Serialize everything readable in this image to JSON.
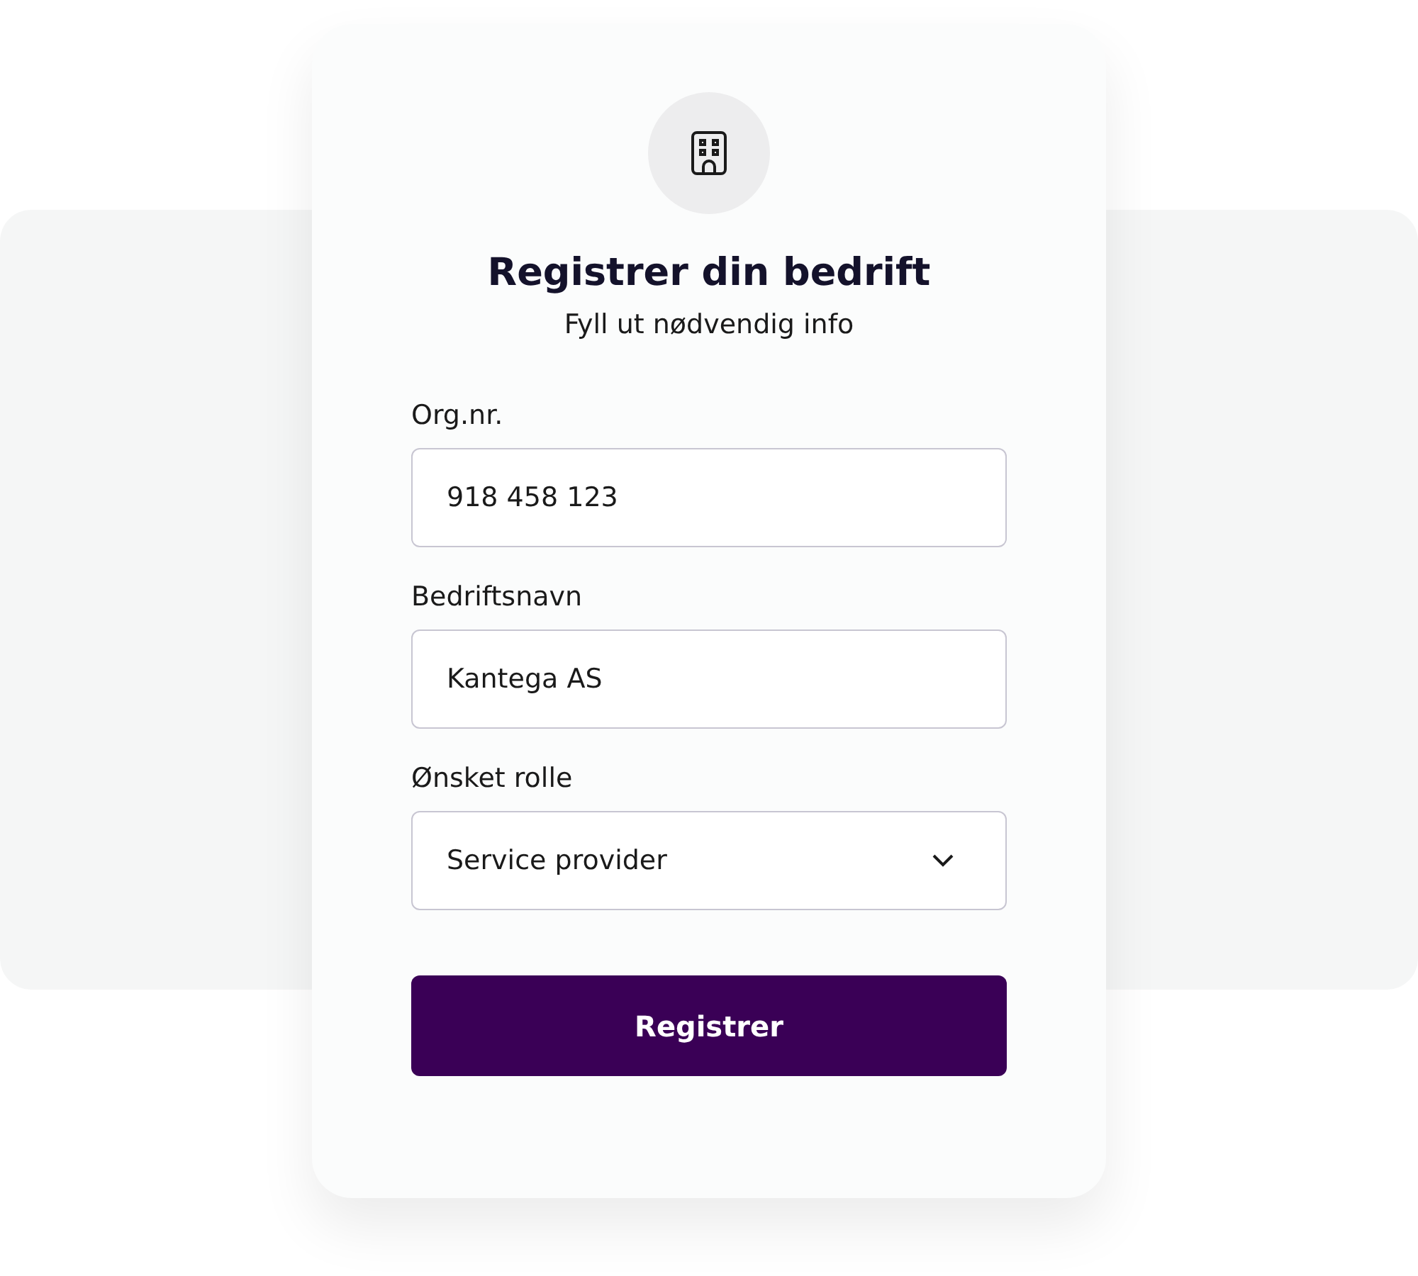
{
  "card": {
    "title": "Registrer din bedrift",
    "subtitle": "Fyll ut nødvendig info"
  },
  "fields": [
    {
      "kind": "text",
      "label": "Org.nr.",
      "value": "918 458 123"
    },
    {
      "kind": "text",
      "label": "Bedriftsnavn",
      "value": "Kantega AS"
    },
    {
      "kind": "select",
      "label": "Ønsket rolle",
      "value": "Service provider"
    }
  ],
  "submit": "Registrer"
}
